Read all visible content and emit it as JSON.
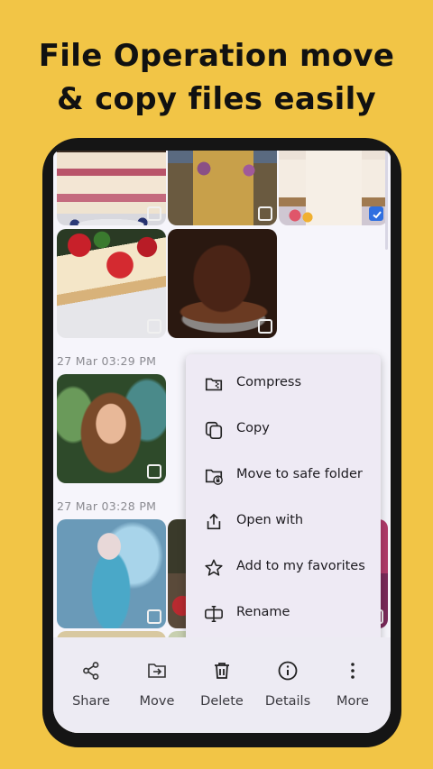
{
  "headline": {
    "line1": "File Operation move",
    "line2": "& copy files easily"
  },
  "gallery": {
    "groups": [
      {
        "date": "27 Mar 03:29 PM"
      },
      {
        "date": "27 Mar 03:28 PM"
      }
    ]
  },
  "context_menu": {
    "items": [
      {
        "label": "Compress",
        "icon": "compress-icon"
      },
      {
        "label": "Copy",
        "icon": "copy-icon"
      },
      {
        "label": "Move to safe folder",
        "icon": "safe-folder-icon"
      },
      {
        "label": "Open with",
        "icon": "open-with-icon"
      },
      {
        "label": "Add to my favorites",
        "icon": "star-icon"
      },
      {
        "label": "Rename",
        "icon": "rename-icon"
      }
    ]
  },
  "bottom_bar": {
    "items": [
      {
        "label": "Share",
        "icon": "share-icon"
      },
      {
        "label": "Move",
        "icon": "move-icon"
      },
      {
        "label": "Delete",
        "icon": "trash-icon"
      },
      {
        "label": "Details",
        "icon": "info-icon"
      },
      {
        "label": "More",
        "icon": "more-vertical-icon"
      }
    ]
  },
  "colors": {
    "background": "#F2C546",
    "accent_check": "#2F6FE0",
    "menu_bg": "#EEEAF4",
    "bottom_bar_bg": "#EDEBF3"
  }
}
